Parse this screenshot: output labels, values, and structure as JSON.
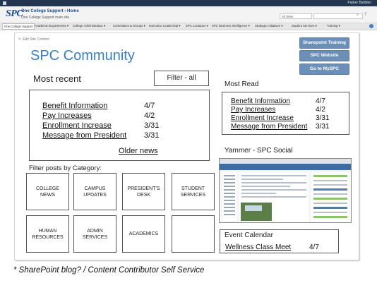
{
  "chrome": {
    "user_name": "Parker Baldwin",
    "logo": "SPC",
    "site_title": "One College Support › Home",
    "site_subtitle": "One College Support main site",
    "search_scope": "All Sites",
    "nav_items": [
      "One College Support",
      "Academic Departments ▾",
      "College Administration ▾",
      "Committees & Groups ▾",
      "Executive Leadership ▾",
      "SPC Locations ▾",
      "SPC Business Intelligence ▾",
      "Strategic Initiatives ▾",
      "Student Services ▾",
      "Training ▾"
    ]
  },
  "page": {
    "edit_link": "Edit Site Content",
    "title": "SPC Community",
    "buttons": {
      "sharepoint_training": "Sharepoint Training",
      "spc_website": "SPC Website",
      "go_to_myspc": "Go to MySPC"
    }
  },
  "most_recent": {
    "heading": "Most recent",
    "filter_label": "Filter - all",
    "items": [
      {
        "title": "Benefit Information",
        "date": "4/7"
      },
      {
        "title": "Pay Increases",
        "date": "4/2"
      },
      {
        "title": "Enrollment Increase",
        "date": "3/31"
      },
      {
        "title": "Message from President",
        "date": "3/31"
      }
    ],
    "older_news": "Older news"
  },
  "categories": {
    "heading": "Filter posts by Category:",
    "items": [
      "COLLEGE NEWS",
      "CAMPUS UPDATES",
      "PRESIDENT'S DESK",
      "STUDENT SERVICES",
      "HUMAN RESOURCES",
      "ADMIN SERVICES",
      "ACADEMICS",
      ""
    ]
  },
  "most_read": {
    "heading": "Most Read",
    "items": [
      {
        "title": "Benefit Information",
        "date": "4/7"
      },
      {
        "title": "Pay Increases",
        "date": "4/2"
      },
      {
        "title": "Enrollment Increase",
        "date": "3/31"
      },
      {
        "title": "Message from President",
        "date": "3/31"
      }
    ]
  },
  "yammer": {
    "heading": "Yammer - SPC Social"
  },
  "event_calendar": {
    "heading": "Event Calendar",
    "event": {
      "title": "Wellness Class Meet",
      "date": "4/7"
    }
  },
  "footnote": "* SharePoint blog? / Content Contributor Self Service",
  "colors": {
    "accent": "#3a7fc2",
    "button": "#6c8fb8",
    "topbar": "#24364f"
  }
}
